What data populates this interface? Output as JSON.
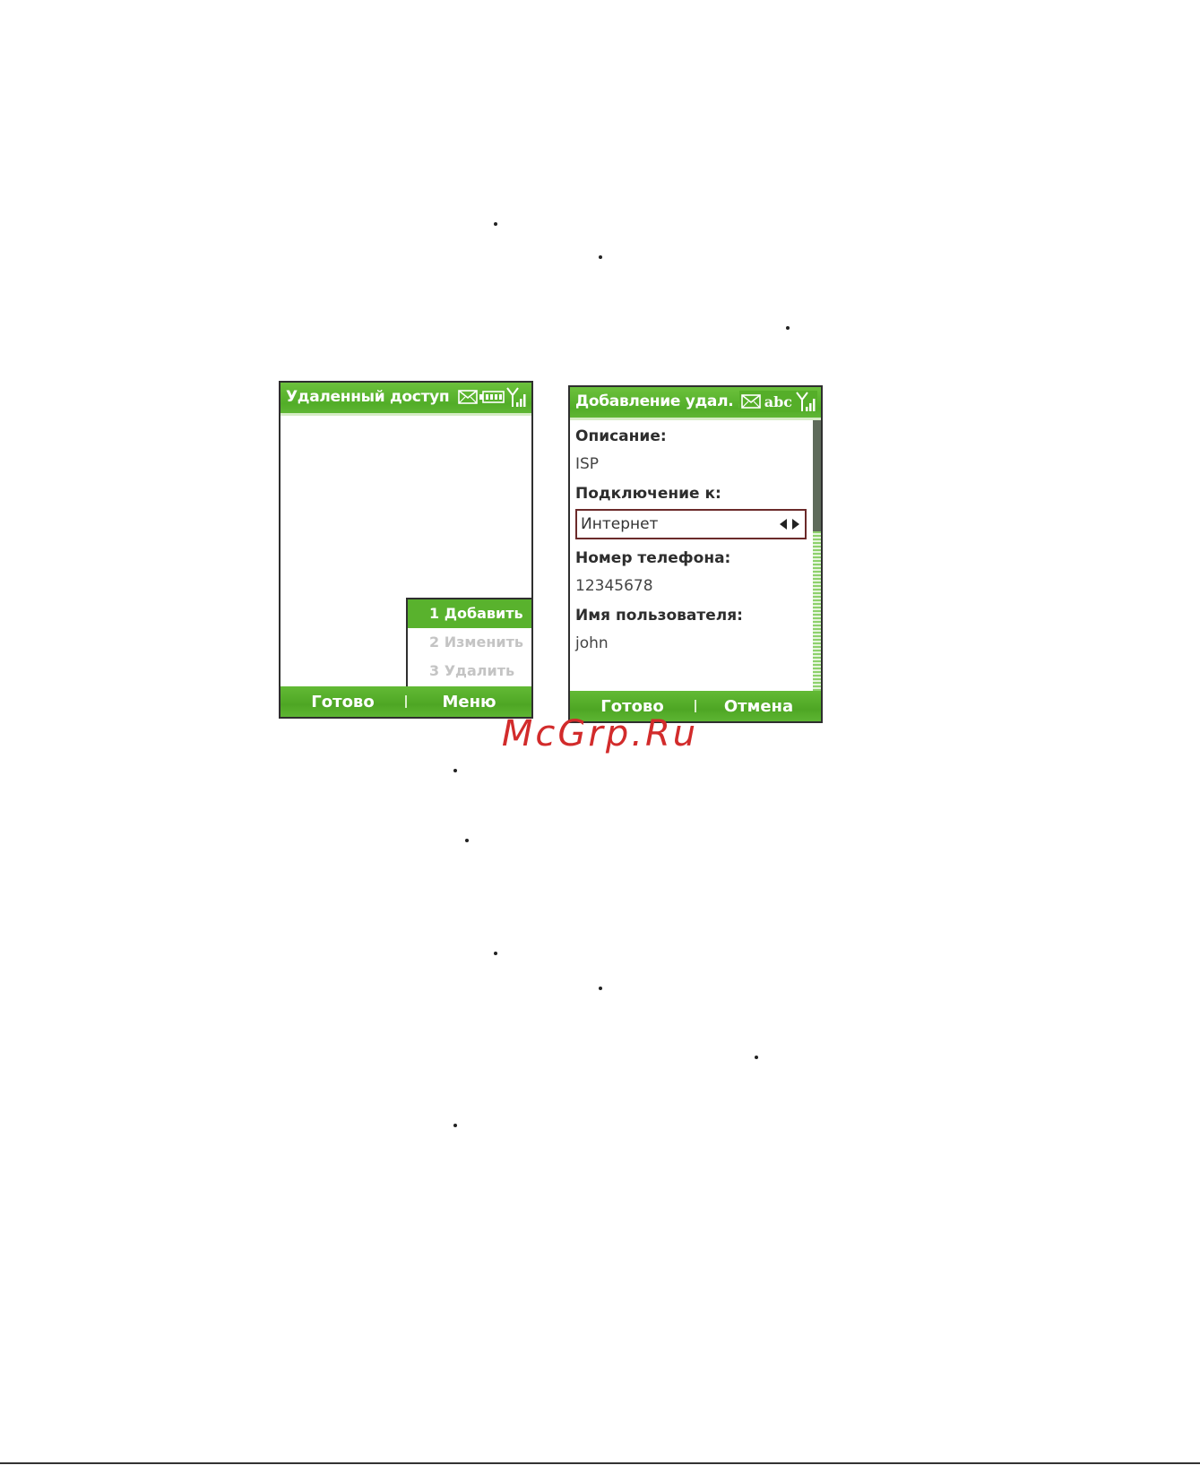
{
  "screen1": {
    "title": "Удаленный доступ",
    "menu": [
      {
        "label": "1 Добавить",
        "selected": true
      },
      {
        "label": "2 Изменить",
        "selected": false
      },
      {
        "label": "3 Удалить",
        "selected": false
      }
    ],
    "softkeys": {
      "left": "Готово",
      "right": "Меню"
    }
  },
  "screen2": {
    "title": "Добавление удал. досту",
    "input_mode": "abc",
    "fields": {
      "description": {
        "label": "Описание:",
        "value": "ISP"
      },
      "connect_to": {
        "label": "Подключение к:",
        "value": "Интернет"
      },
      "phone": {
        "label": "Номер телефона:",
        "value": "12345678"
      },
      "username": {
        "label": "Имя пользователя:",
        "value": "john"
      }
    },
    "softkeys": {
      "left": "Готово",
      "right": "Отмена"
    }
  },
  "watermark": "McGrp.Ru",
  "icons": [
    "envelope-icon",
    "battery-icon",
    "signal-icon",
    "arrow-left-icon",
    "arrow-right-icon"
  ],
  "colors": {
    "accent": "#55ae29",
    "watermark": "#d22b2b"
  }
}
